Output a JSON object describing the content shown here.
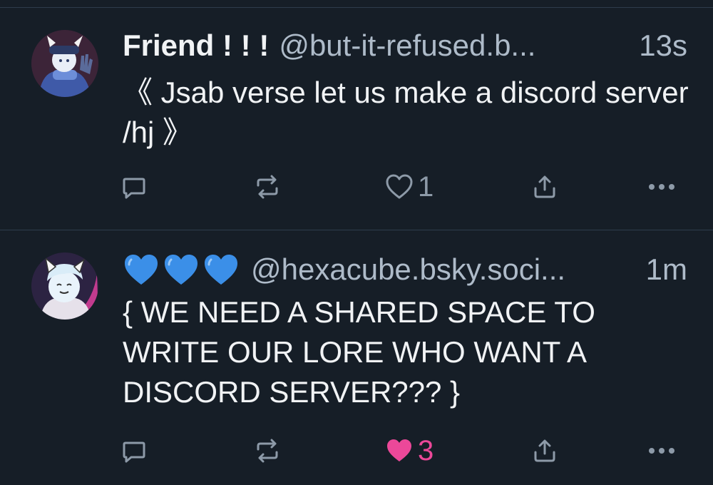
{
  "posts": [
    {
      "display_name": "Friend ! ! !",
      "handle": "@but-it-refused.b...",
      "time": "13s",
      "text": "《 Jsab verse let us make a discord server /hj 》",
      "like_count": "1",
      "liked": false,
      "avatar_icon": "cat-eared-character-waving-avatar"
    },
    {
      "display_name_emoji": [
        "blue-heart-icon",
        "blue-heart-icon",
        "blue-heart-icon"
      ],
      "handle": "@hexacube.bsky.soci...",
      "time": "1m",
      "text": "{ WE NEED A SHARED SPACE TO WRITE OUR LORE WHO WANT A DISCORD SERVER??? }",
      "like_count": "3",
      "liked": true,
      "avatar_icon": "cat-eared-smiling-character-avatar"
    }
  ],
  "colors": {
    "background": "#161e27",
    "divider": "#2e3c4c",
    "text": "#f1f3f5",
    "muted": "#aebbc9",
    "icon": "#8d9aa8",
    "liked": "#ec4899",
    "heart_emoji": "#3b8fe8"
  }
}
